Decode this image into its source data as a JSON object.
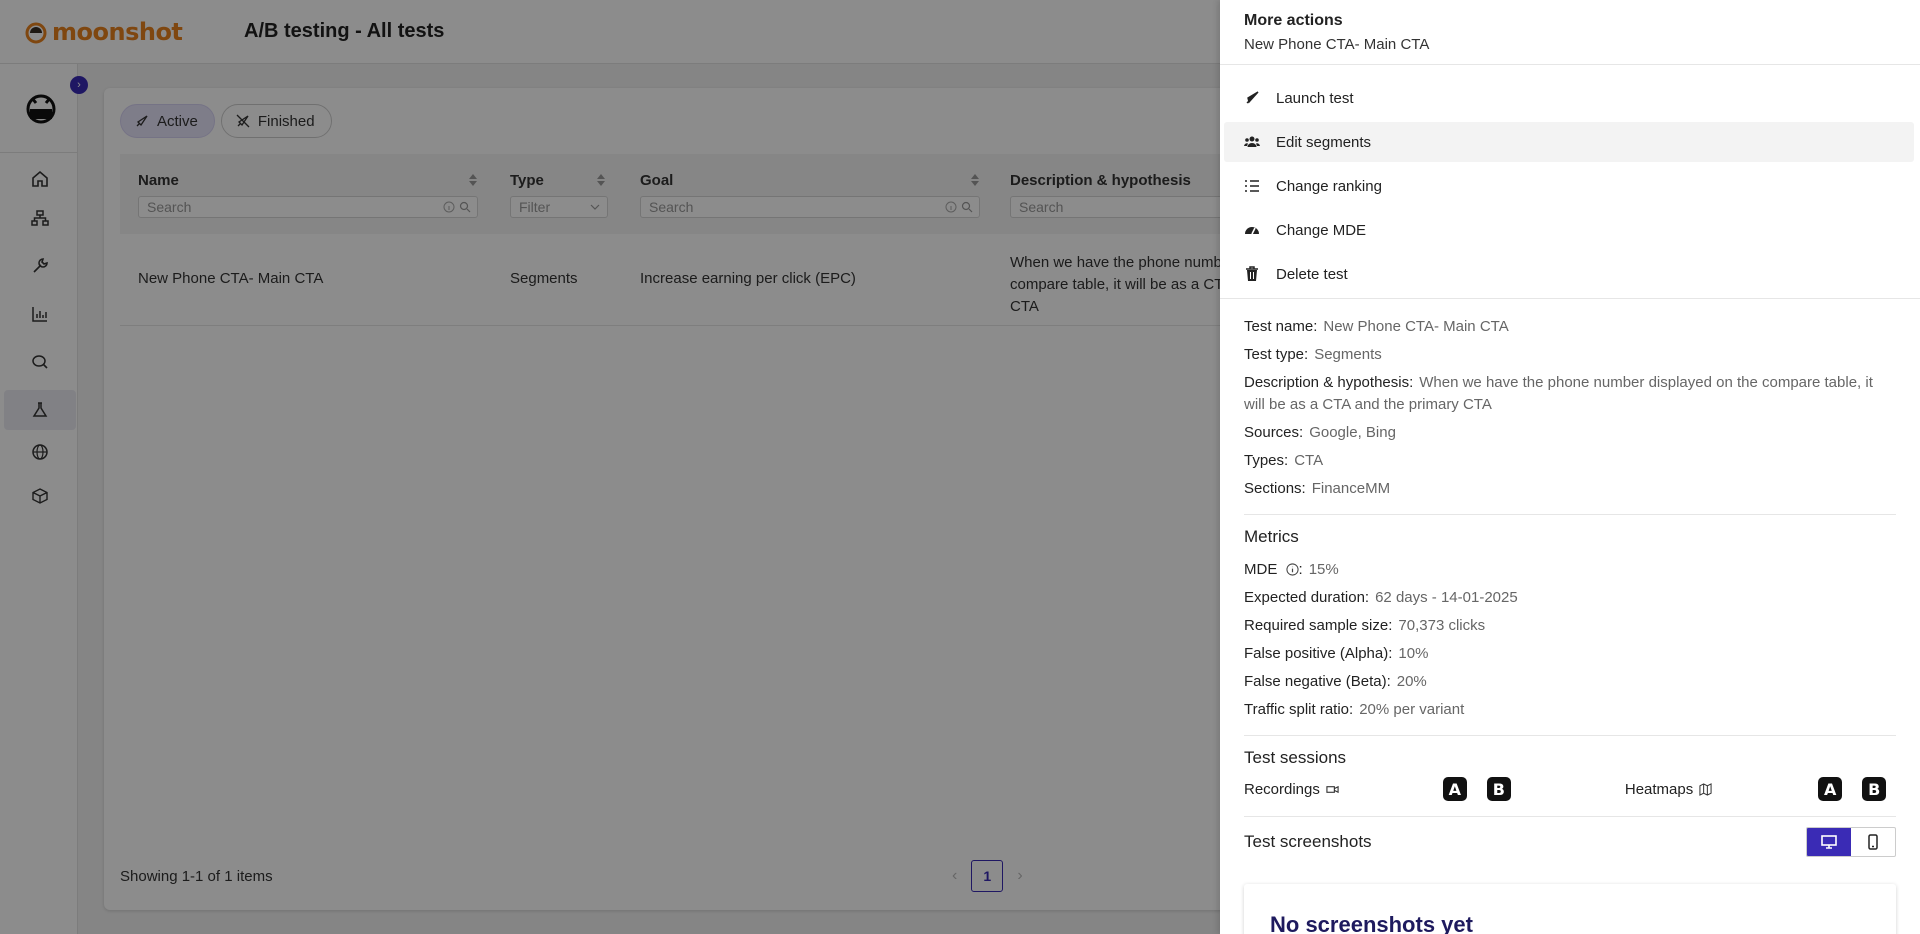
{
  "app": {
    "logo_text": "moonshot",
    "page_title": "A/B testing - All tests"
  },
  "sidebar": {
    "items": [
      {
        "icon": "home-icon"
      },
      {
        "icon": "sitemap-icon"
      },
      {
        "icon": "tools-icon"
      },
      {
        "icon": "chart-icon"
      },
      {
        "icon": "search-chat-icon"
      },
      {
        "icon": "flask-icon",
        "active": true
      },
      {
        "icon": "globe-icon"
      },
      {
        "icon": "box-icon"
      }
    ]
  },
  "tabs": [
    {
      "label": "Active",
      "active": true
    },
    {
      "label": "Finished",
      "active": false
    }
  ],
  "table": {
    "columns": [
      {
        "title": "Name",
        "placeholder": "Search"
      },
      {
        "title": "Type",
        "placeholder": "Filter"
      },
      {
        "title": "Goal",
        "placeholder": "Search"
      },
      {
        "title": "Description & hypothesis",
        "placeholder": "Search"
      }
    ],
    "rows": [
      {
        "name": "New Phone CTA- Main CTA",
        "type": "Segments",
        "goal": "Increase earning per click (EPC)",
        "description": "When we have the phone number compare table, it will be as a CTA CTA"
      }
    ],
    "footer": "Showing 1-1 of 1 items",
    "page": "1"
  },
  "drawer": {
    "title": "More actions",
    "subtitle": "New Phone CTA- Main CTA",
    "actions": [
      {
        "label": "Launch test",
        "icon": "rocket-icon"
      },
      {
        "label": "Edit segments",
        "icon": "users-icon"
      },
      {
        "label": "Change ranking",
        "icon": "list-ordered-icon"
      },
      {
        "label": "Change MDE",
        "icon": "gauge-icon"
      },
      {
        "label": "Delete test",
        "icon": "trash-icon"
      }
    ],
    "details": {
      "test_name": {
        "k": "Test name:",
        "v": "New Phone CTA- Main CTA"
      },
      "test_type": {
        "k": "Test type:",
        "v": "Segments"
      },
      "description": {
        "k": "Description & hypothesis:",
        "v": "When we have the phone number displayed on the compare table, it will be as a CTA and the primary CTA"
      },
      "sources": {
        "k": "Sources:",
        "v": "Google, Bing"
      },
      "types": {
        "k": "Types:",
        "v": "CTA"
      },
      "sections": {
        "k": "Sections:",
        "v": "FinanceMM"
      }
    },
    "metrics": {
      "title": "Metrics",
      "mde": {
        "k": "MDE",
        "v": "15%"
      },
      "duration": {
        "k": "Expected duration:",
        "v": "62 days - 14-01-2025"
      },
      "sample": {
        "k": "Required sample size:",
        "v": "70,373 clicks"
      },
      "alpha": {
        "k": "False positive (Alpha):",
        "v": "10%"
      },
      "beta": {
        "k": "False negative (Beta):",
        "v": "20%"
      },
      "split": {
        "k": "Traffic split ratio:",
        "v": "20% per variant"
      }
    },
    "sessions": {
      "title": "Test sessions",
      "recordings": "Recordings",
      "heatmaps": "Heatmaps",
      "variant_a": "A",
      "variant_b": "B"
    },
    "screenshots": {
      "title": "Test screenshots",
      "empty_title": "No screenshots yet"
    }
  },
  "colors": {
    "accent": "#3a2bb5",
    "brand": "#e8821e"
  }
}
